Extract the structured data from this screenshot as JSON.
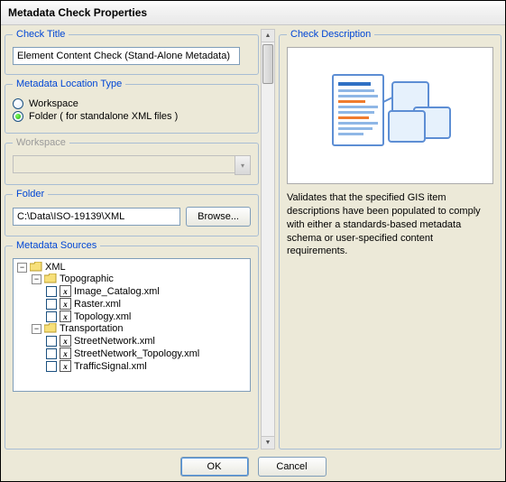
{
  "title": "Metadata Check Properties",
  "checkTitle": {
    "legend": "Check Title",
    "value": "Element Content Check (Stand-Alone Metadata)"
  },
  "locationType": {
    "legend": "Metadata Location Type",
    "options": {
      "workspace": {
        "label": "Workspace",
        "selected": false
      },
      "folder": {
        "label": "Folder ( for standalone XML files )",
        "selected": true
      }
    }
  },
  "workspace": {
    "legend": "Workspace",
    "value": ""
  },
  "folder": {
    "legend": "Folder",
    "path": "C:\\Data\\ISO-19139\\XML",
    "browse": "Browse..."
  },
  "sources": {
    "legend": "Metadata Sources",
    "root": "XML",
    "groups": [
      {
        "name": "Topographic",
        "files": [
          "Image_Catalog.xml",
          "Raster.xml",
          "Topology.xml"
        ]
      },
      {
        "name": "Transportation",
        "files": [
          "StreetNetwork.xml",
          "StreetNetwork_Topology.xml",
          "TrafficSignal.xml"
        ]
      }
    ]
  },
  "description": {
    "legend": "Check Description",
    "text": "Validates that the specified GIS item descriptions have been populated to comply with either a standards-based metadata schema or user-specified content requirements."
  },
  "buttons": {
    "ok": "OK",
    "cancel": "Cancel"
  }
}
